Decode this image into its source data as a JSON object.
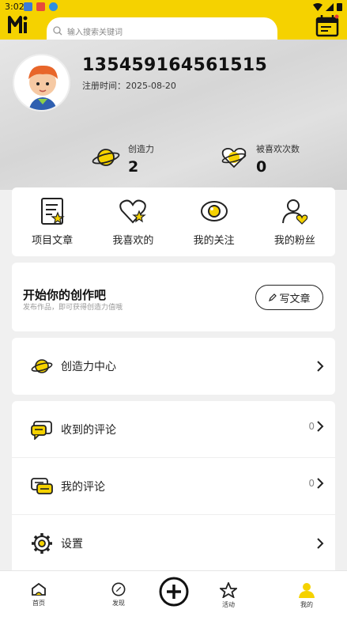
{
  "status": {
    "time": "3:02"
  },
  "search": {
    "placeholder": "输入搜索关键词"
  },
  "profile": {
    "phone": "135459164561515",
    "reg_date": "注册时间：2025-08-20"
  },
  "stats": [
    {
      "label": "创造力",
      "value": "2"
    },
    {
      "label": "被喜欢次数",
      "value": "0"
    }
  ],
  "grid": [
    {
      "label": "项目文章",
      "icon": "article-icon"
    },
    {
      "label": "我喜欢的",
      "icon": "heart-star-icon"
    },
    {
      "label": "我的关注",
      "icon": "eye-icon"
    },
    {
      "label": "我的粉丝",
      "icon": "user-heart-icon"
    }
  ],
  "create": {
    "title": "开始你的创作吧",
    "subtitle": "发布作品，即可获得创造力值哦",
    "button": "写文章"
  },
  "menu": {
    "creativity": "创造力中心",
    "received_comments": {
      "label": "收到的评论",
      "count": "0"
    },
    "my_comments": {
      "label": "我的评论",
      "count": "0"
    },
    "settings": "设置"
  },
  "nav": [
    "首页",
    "发现",
    "活动",
    "我的"
  ],
  "colors": {
    "accent": "#f5d200",
    "bg": "#f0f0f0"
  }
}
